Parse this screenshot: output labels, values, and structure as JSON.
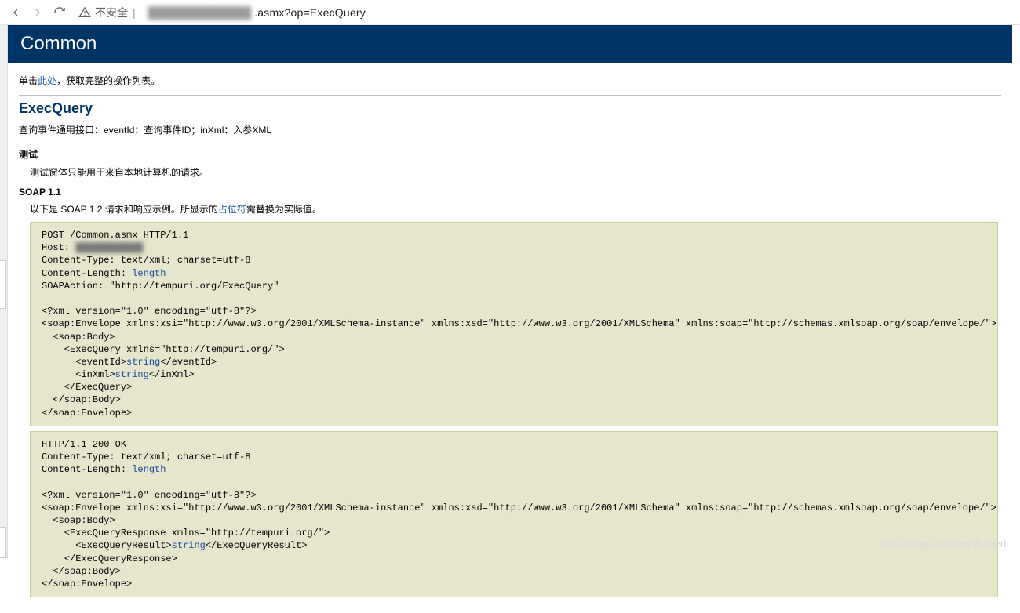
{
  "chrome": {
    "security_label": "不安全",
    "url_hidden": "█████████████",
    "url_suffix": ".asmx?op=ExecQuery"
  },
  "banner": {
    "title": "Common"
  },
  "oplist": {
    "prefix": "单击",
    "link": "此处",
    "suffix": "，获取完整的操作列表。"
  },
  "op": {
    "name": "ExecQuery",
    "description": "查询事件通用接口：eventId：查询事件ID；inXml：入参XML"
  },
  "test": {
    "heading": "测试",
    "msg": "测试窗体只能用于来自本地计算机的请求。"
  },
  "soap": {
    "heading": "SOAP 1.1",
    "intro_prefix": "以下是 SOAP 1.2 请求和响应示例。所显示的",
    "intro_link": "占位符",
    "intro_suffix": "需替换为实际值。",
    "request_lines": [
      {
        "t": "POST /Common.asmx HTTP/1.1"
      },
      {
        "t": "Host: ",
        "host_blur": "████████████"
      },
      {
        "t": "Content-Type: text/xml; charset=utf-8"
      },
      {
        "t": "Content-Length: ",
        "k": "length"
      },
      {
        "t": "SOAPAction: \"http://tempuri.org/ExecQuery\""
      },
      {
        "t": ""
      },
      {
        "t": "<?xml version=\"1.0\" encoding=\"utf-8\"?>"
      },
      {
        "t": "<soap:Envelope xmlns:xsi=\"http://www.w3.org/2001/XMLSchema-instance\" xmlns:xsd=\"http://www.w3.org/2001/XMLSchema\" xmlns:soap=\"http://schemas.xmlsoap.org/soap/envelope/\">"
      },
      {
        "t": "  <soap:Body>"
      },
      {
        "t": "    <ExecQuery xmlns=\"http://tempuri.org/\">"
      },
      {
        "t": "      <eventId>",
        "k": "string",
        "t2": "</eventId>"
      },
      {
        "t": "      <inXml>",
        "k": "string",
        "t2": "</inXml>"
      },
      {
        "t": "    </ExecQuery>"
      },
      {
        "t": "  </soap:Body>"
      },
      {
        "t": "</soap:Envelope>"
      }
    ],
    "response_lines": [
      {
        "t": "HTTP/1.1 200 OK"
      },
      {
        "t": "Content-Type: text/xml; charset=utf-8"
      },
      {
        "t": "Content-Length: ",
        "k": "length"
      },
      {
        "t": ""
      },
      {
        "t": "<?xml version=\"1.0\" encoding=\"utf-8\"?>"
      },
      {
        "t": "<soap:Envelope xmlns:xsi=\"http://www.w3.org/2001/XMLSchema-instance\" xmlns:xsd=\"http://www.w3.org/2001/XMLSchema\" xmlns:soap=\"http://schemas.xmlsoap.org/soap/envelope/\">"
      },
      {
        "t": "  <soap:Body>"
      },
      {
        "t": "    <ExecQueryResponse xmlns=\"http://tempuri.org/\">"
      },
      {
        "t": "      <ExecQueryResult>",
        "k": "string",
        "t2": "</ExecQueryResult>"
      },
      {
        "t": "    </ExecQueryResponse>"
      },
      {
        "t": "  </soap:Body>"
      },
      {
        "t": "</soap:Envelope>"
      }
    ]
  },
  "watermark": "https://blog.csdn.net/Ratherl"
}
